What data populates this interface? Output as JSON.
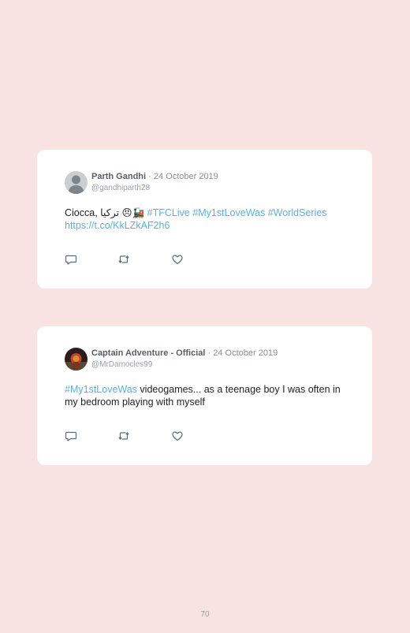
{
  "tweets": [
    {
      "author": "Parth Gandhi",
      "separator": " · ",
      "date": "24 October 2019",
      "handle": "@gandhiparth28",
      "text_prefix": "Ciocca, تركيا 😠🚂 ",
      "hashtag1": "#TFCLive",
      "hashtag2": "#My1stLoveWas",
      "hashtag3": "#WorldSeries",
      "link": "https://t.co/KkLZkAF2h6",
      "avatar": "default-user-avatar"
    },
    {
      "author": "Captain Adventure - Official",
      "separator": " · ",
      "date": "24 October 2019",
      "handle": "@MrDamocles99",
      "hashtag1": "#My1stLoveWas",
      "text_rest": " videogames... as a teenage boy I was often in my bedroom playing with myself",
      "avatar": "photo-avatar"
    }
  ],
  "icons": {
    "reply": "reply-icon",
    "retweet": "retweet-icon",
    "like": "heart-icon"
  },
  "colors": {
    "background": "#f8e3e2",
    "card": "#ffffff",
    "hashtag": "#5ab0e2",
    "text": "#1f1f1f"
  },
  "page_number": "70"
}
